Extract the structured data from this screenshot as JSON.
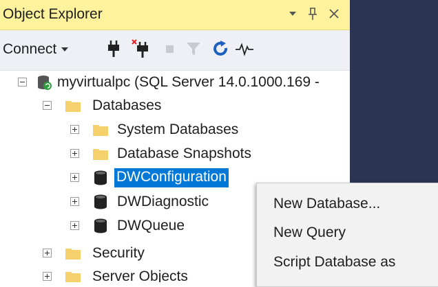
{
  "window": {
    "title": "Object Explorer",
    "controls": [
      "▾",
      "⊥",
      "✕"
    ]
  },
  "toolbar": {
    "connect_label": "Connect",
    "icons": [
      "connect-plug-icon",
      "disconnect-plug-icon",
      "stop-icon",
      "filter-icon",
      "refresh-icon",
      "activity-monitor-icon"
    ]
  },
  "tree": {
    "server": "myvirtualpc (SQL Server 14.0.1000.169 -",
    "databases": "Databases",
    "system_databases": "System Databases",
    "database_snapshots": "Database Snapshots",
    "dwconfiguration": "DWConfiguration",
    "dwdiagnostics": "DWDiagnostic",
    "dwqueue": "DWQueue",
    "security": "Security",
    "server_objects": "Server Objects"
  },
  "context_menu": {
    "new_database": "New Database...",
    "new_query": "New Query",
    "script_database_as": "Script Database as"
  },
  "colors": {
    "title_bg": "#fff29d",
    "selection": "#0078d7",
    "dark_area": "#2b3553",
    "folder": "#f5d06b"
  }
}
